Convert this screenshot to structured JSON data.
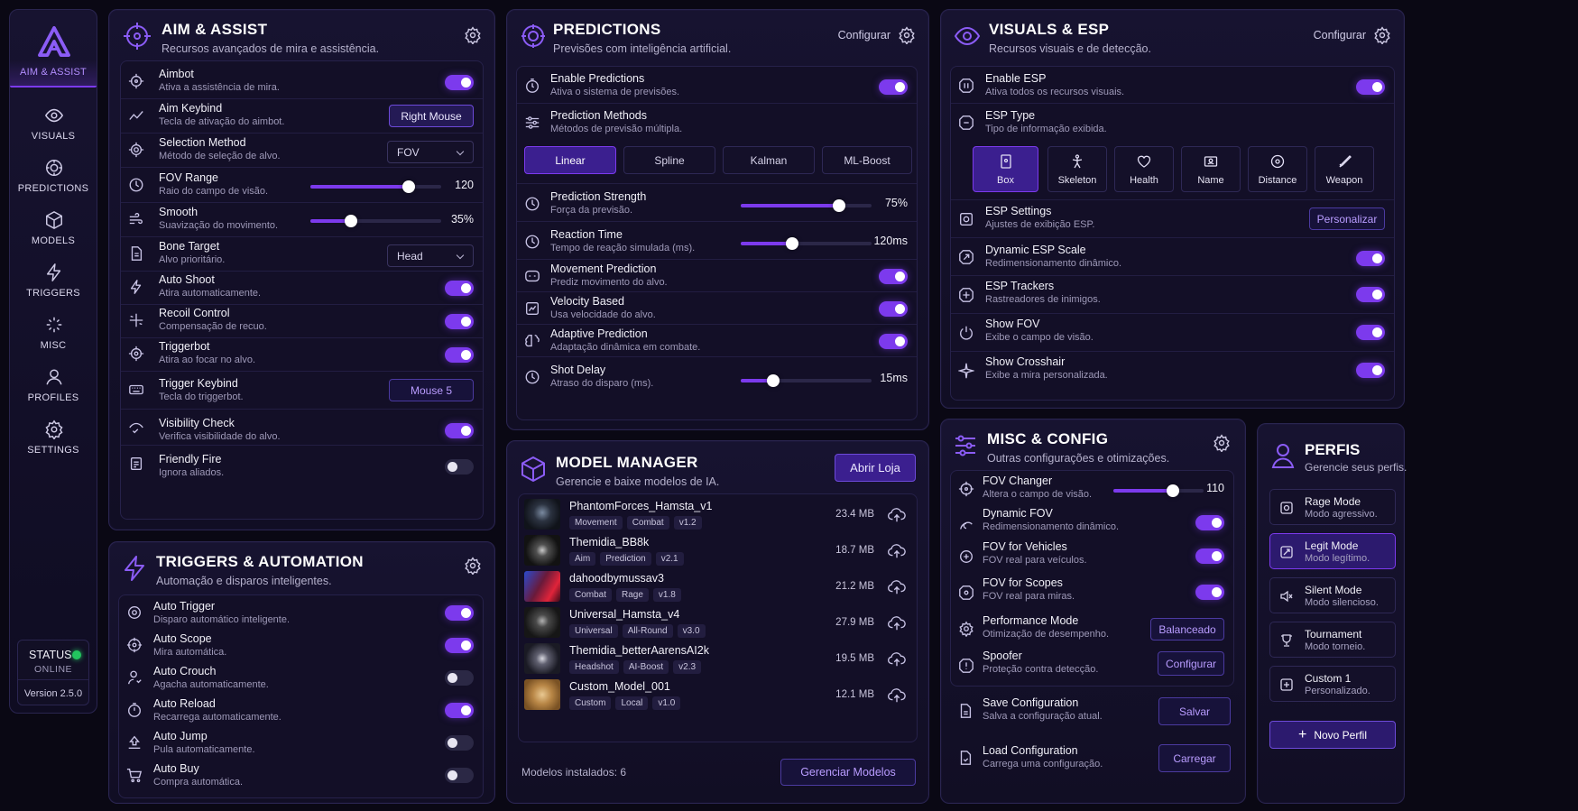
{
  "colors": {
    "accent": "#7c3aed",
    "online": "#22c55e",
    "bg": "#0a0814"
  },
  "nav": {
    "brand": "AIM & ASSIST",
    "items": [
      {
        "label": "VISUALS",
        "icon": "eye-icon"
      },
      {
        "label": "PREDICTIONS",
        "icon": "brain-icon"
      },
      {
        "label": "MODELS",
        "icon": "cube-icon"
      },
      {
        "label": "TRIGGERS",
        "icon": "bolt-icon"
      },
      {
        "label": "MISC",
        "icon": "sparkle-icon"
      },
      {
        "label": "PROFILES",
        "icon": "user-icon"
      },
      {
        "label": "SETTINGS",
        "icon": "gear-icon"
      }
    ],
    "status_label": "STATUS",
    "status_value": "ONLINE",
    "version": "Version 2.5.0"
  },
  "aim": {
    "title": "AIM & ASSIST",
    "subtitle": "Recursos avançados de mira e assistência.",
    "aimbot": {
      "label": "Aimbot",
      "sub": "Ativa a assistência de mira.",
      "on": true
    },
    "keybind": {
      "label": "Aim Keybind",
      "sub": "Tecla de ativação do aimbot.",
      "value": "Right Mouse"
    },
    "selection": {
      "label": "Selection Method",
      "sub": "Método de seleção de alvo.",
      "value": "FOV"
    },
    "fov": {
      "label": "FOV Range",
      "sub": "Raio do campo de visão.",
      "value": "120",
      "level": 0.75
    },
    "smooth": {
      "label": "Smooth",
      "sub": "Suavização do movimento.",
      "value": "35%",
      "level": 0.31
    },
    "bone": {
      "label": "Bone Target",
      "sub": "Alvo prioritário.",
      "value": "Head"
    },
    "autoshoot": {
      "label": "Auto Shoot",
      "sub": "Atira automaticamente.",
      "on": true
    },
    "recoil": {
      "label": "Recoil Control",
      "sub": "Compensação de recuo.",
      "on": true
    },
    "triggerbot": {
      "label": "Triggerbot",
      "sub": "Atira ao focar no alvo.",
      "on": true
    },
    "trigkey": {
      "label": "Trigger Keybind",
      "sub": "Tecla do triggerbot.",
      "value": "Mouse 5"
    },
    "visibility": {
      "label": "Visibility Check",
      "sub": "Verifica visibilidade do alvo.",
      "on": true
    },
    "friendly": {
      "label": "Friendly Fire",
      "sub": "Ignora aliados.",
      "on": false
    }
  },
  "triggers": {
    "title": "TRIGGERS & AUTOMATION",
    "subtitle": "Automação e disparos inteligentes.",
    "items": [
      {
        "label": "Auto Trigger",
        "sub": "Disparo automático inteligente.",
        "on": true
      },
      {
        "label": "Auto Scope",
        "sub": "Mira automática.",
        "on": true
      },
      {
        "label": "Auto Crouch",
        "sub": "Agacha automaticamente.",
        "on": false
      },
      {
        "label": "Auto Reload",
        "sub": "Recarrega automaticamente.",
        "on": true
      },
      {
        "label": "Auto Jump",
        "sub": "Pula automaticamente.",
        "on": false
      },
      {
        "label": "Auto Buy",
        "sub": "Compra automática.",
        "on": false
      }
    ]
  },
  "pred": {
    "title": "PREDICTIONS",
    "subtitle": "Previsões com inteligência artificial.",
    "configure": "Configurar",
    "enable": {
      "label": "Enable Predictions",
      "sub": "Ativa o sistema de previsões.",
      "on": true
    },
    "methods": {
      "label": "Prediction Methods",
      "sub": "Métodos de previsão múltipla.",
      "options": [
        "Linear",
        "Spline",
        "Kalman",
        "ML-Boost"
      ],
      "selected": "Linear"
    },
    "strength": {
      "label": "Prediction Strength",
      "sub": "Força da previsão.",
      "value": "75%",
      "level": 0.75
    },
    "reaction": {
      "label": "Reaction Time",
      "sub": "Tempo de reação simulada (ms).",
      "value": "120ms",
      "level": 0.39
    },
    "movement": {
      "label": "Movement Prediction",
      "sub": "Prediz movimento do alvo.",
      "on": true
    },
    "velocity": {
      "label": "Velocity Based",
      "sub": "Usa velocidade do alvo.",
      "on": true
    },
    "adaptive": {
      "label": "Adaptive Prediction",
      "sub": "Adaptação dinâmica em combate.",
      "on": true
    },
    "shotdelay": {
      "label": "Shot Delay",
      "sub": "Atraso do disparo (ms).",
      "value": "15ms",
      "level": 0.25
    }
  },
  "models": {
    "title": "MODEL MANAGER",
    "subtitle": "Gerencie e baixe modelos de IA.",
    "store": "Abrir Loja",
    "items": [
      {
        "name": "PhantomForces_Hamsta_v1",
        "tags": [
          "Movement",
          "Combat",
          "v1.2"
        ],
        "size": "23.4 MB"
      },
      {
        "name": "Themidia_BB8k",
        "tags": [
          "Aim",
          "Prediction",
          "v2.1"
        ],
        "size": "18.7 MB"
      },
      {
        "name": "dahoodbymussav3",
        "tags": [
          "Combat",
          "Rage",
          "v1.8"
        ],
        "size": "21.2 MB"
      },
      {
        "name": "Universal_Hamsta_v4",
        "tags": [
          "Universal",
          "All-Round",
          "v3.0"
        ],
        "size": "27.9 MB"
      },
      {
        "name": "Themidia_betterAarensAI2k",
        "tags": [
          "Headshot",
          "AI-Boost",
          "v2.3"
        ],
        "size": "19.5 MB"
      },
      {
        "name": "Custom_Model_001",
        "tags": [
          "Custom",
          "Local",
          "v1.0"
        ],
        "size": "12.1 MB"
      }
    ],
    "installed": "Modelos instalados: 6",
    "manage": "Gerenciar Modelos"
  },
  "esp": {
    "title": "VISUALS & ESP",
    "subtitle": "Recursos visuais e de detecção.",
    "configure": "Configurar",
    "enable": {
      "label": "Enable ESP",
      "sub": "Ativa todos os recursos visuais.",
      "on": true
    },
    "type": {
      "label": "ESP Type",
      "sub": "Tipo de informação exibida.",
      "options": [
        "Box",
        "Skeleton",
        "Health",
        "Name",
        "Distance",
        "Weapon"
      ],
      "selected": "Box"
    },
    "settings": {
      "label": "ESP Settings",
      "sub": "Ajustes de exibição ESP.",
      "button": "Personalizar"
    },
    "scale": {
      "label": "Dynamic ESP Scale",
      "sub": "Redimensionamento dinâmico.",
      "on": true
    },
    "trackers": {
      "label": "ESP Trackers",
      "sub": "Rastreadores de inimigos.",
      "on": true
    },
    "fov": {
      "label": "Show FOV",
      "sub": "Exibe o campo de visão.",
      "on": true
    },
    "crosshair": {
      "label": "Show Crosshair",
      "sub": "Exibe a mira personalizada.",
      "on": true
    }
  },
  "misc": {
    "title": "MISC & CONFIG",
    "subtitle": "Outras configurações e otimizações.",
    "fovchanger": {
      "label": "FOV Changer",
      "sub": "Altera o campo de visão.",
      "value": "110",
      "level": 0.66
    },
    "dynfov": {
      "label": "Dynamic FOV",
      "sub": "Redimensionamento dinâmico.",
      "on": true
    },
    "vehicles": {
      "label": "FOV for Vehicles",
      "sub": "FOV real para veículos.",
      "on": true
    },
    "scopes": {
      "label": "FOV for Scopes",
      "sub": "FOV real para miras.",
      "on": true
    },
    "perf": {
      "label": "Performance Mode",
      "sub": "Otimização de desempenho.",
      "button": "Balanceado"
    },
    "spoofer": {
      "label": "Spoofer",
      "sub": "Proteção contra detecção.",
      "button": "Configurar"
    },
    "save": {
      "label": "Save Configuration",
      "sub": "Salva a configuração atual.",
      "button": "Salvar"
    },
    "load": {
      "label": "Load Configuration",
      "sub": "Carrega uma configuração.",
      "button": "Carregar"
    }
  },
  "profiles": {
    "title": "PERFIS",
    "subtitle": "Gerencie seus perfis.",
    "items": [
      {
        "label": "Rage Mode",
        "sub": "Modo agressivo."
      },
      {
        "label": "Legit Mode",
        "sub": "Modo legítimo."
      },
      {
        "label": "Silent Mode",
        "sub": "Modo silencioso."
      },
      {
        "label": "Tournament",
        "sub": "Modo torneio."
      },
      {
        "label": "Custom 1",
        "sub": "Personalizado."
      }
    ],
    "selected": "Legit Mode",
    "new": "Novo Perfil"
  }
}
